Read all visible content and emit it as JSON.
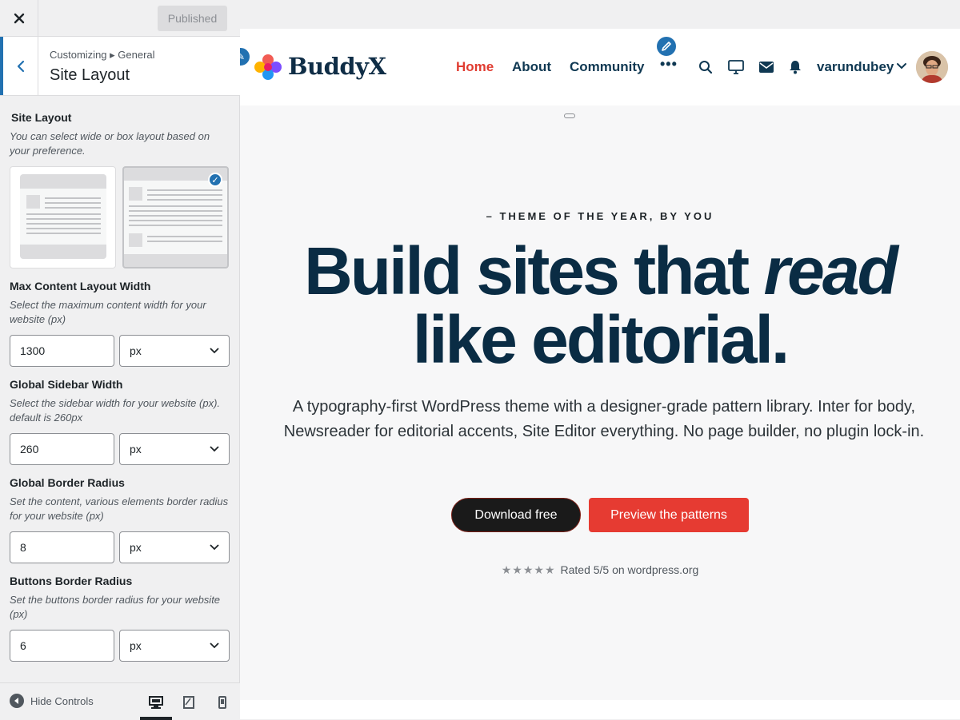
{
  "customizer": {
    "close_icon": "close-icon",
    "publish_label": "Published",
    "breadcrumb": "Customizing ▸ General",
    "section_title": "Site Layout",
    "site_layout": {
      "title": "Site Layout",
      "description": "You can select wide or box layout based on your preference.",
      "options": [
        "boxed",
        "wide"
      ],
      "selected": "wide"
    },
    "max_width": {
      "title": "Max Content Layout Width",
      "description": "Select the maximum content width for your website (px)",
      "value": "1300",
      "unit": "px"
    },
    "sidebar_width": {
      "title": "Global Sidebar Width",
      "description": "Select the sidebar width for your website (px). default is 260px",
      "value": "260",
      "unit": "px"
    },
    "border_radius": {
      "title": "Global Border Radius",
      "description": "Set the content, various elements border radius for your website (px)",
      "value": "8",
      "unit": "px"
    },
    "button_radius": {
      "title": "Buttons Border Radius",
      "description": "Set the buttons border radius for your website (px)",
      "value": "6",
      "unit": "px"
    },
    "footer": {
      "hide_label": "Hide Controls",
      "active_device": "desktop"
    }
  },
  "site": {
    "logo_text": "BuddyX",
    "nav": {
      "home": "Home",
      "about": "About",
      "community": "Community",
      "more": "•••"
    },
    "user_name": "varundubey",
    "hero": {
      "eyebrow": "– THEME OF THE YEAR, BY YOU",
      "headline_part1": "Build sites that ",
      "headline_emph": "read",
      "headline_line2": "like editorial.",
      "subtext": "A typography-first WordPress theme with a designer-grade pattern library. Inter for body, Newsreader for editorial accents, Site Editor everything. No page builder, no plugin lock-in.",
      "primary_button": "Download free",
      "secondary_button": "Preview the patterns",
      "stars": "★★★★★",
      "rating_text": "Rated 5/5 on wordpress.org"
    }
  },
  "colors": {
    "accent_blue": "#2271b1",
    "nav_active": "#e03c31",
    "headline": "#0a2c44",
    "cta_red": "#e63b32"
  }
}
